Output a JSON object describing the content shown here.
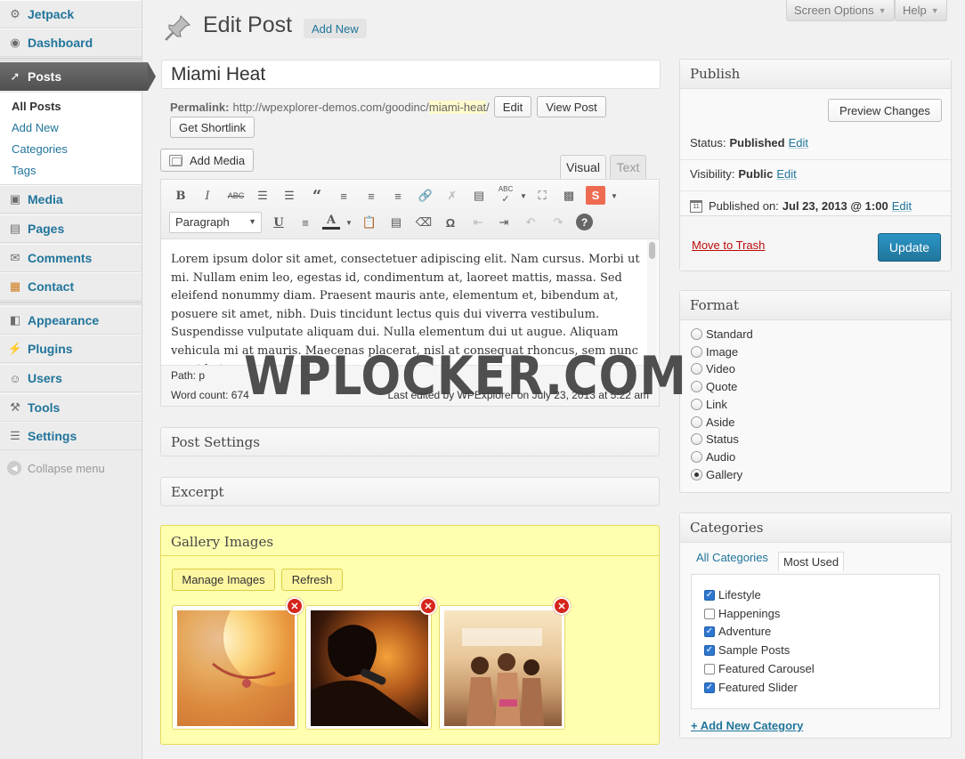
{
  "sidebar": {
    "menu": {
      "jetpack": {
        "label": "Jetpack",
        "icon": "jetpack-icon"
      },
      "dashboard": {
        "label": "Dashboard",
        "icon": "dashboard-icon"
      },
      "posts": {
        "label": "Posts",
        "icon": "pushpin-icon"
      },
      "media": {
        "label": "Media",
        "icon": "media-icon"
      },
      "pages": {
        "label": "Pages",
        "icon": "pages-icon"
      },
      "comments": {
        "label": "Comments",
        "icon": "comments-icon"
      },
      "contact": {
        "label": "Contact",
        "icon": "contact-icon"
      },
      "appearance": {
        "label": "Appearance",
        "icon": "appearance-icon"
      },
      "plugins": {
        "label": "Plugins",
        "icon": "plugins-icon"
      },
      "users": {
        "label": "Users",
        "icon": "users-icon"
      },
      "tools": {
        "label": "Tools",
        "icon": "tools-icon"
      },
      "settings": {
        "label": "Settings",
        "icon": "settings-icon"
      }
    },
    "submenu": [
      "All Posts",
      "Add New",
      "Categories",
      "Tags"
    ],
    "collapse_label": "Collapse menu"
  },
  "header": {
    "title": "Edit Post",
    "add_new": "Add New",
    "screen_options": "Screen Options",
    "help": "Help"
  },
  "post": {
    "title": "Miami Heat",
    "permalink_label": "Permalink:",
    "permalink_base": "http://wpexplorer-demos.com/goodinc/",
    "permalink_slug": "miami-heat",
    "permalink_end": "/",
    "edit_label": "Edit",
    "view_post_label": "View Post",
    "shortlink_label": "Get Shortlink"
  },
  "editor": {
    "add_media": "Add Media",
    "tab_visual": "Visual",
    "tab_text": "Text",
    "format_value": "Paragraph",
    "content": "Lorem ipsum dolor sit amet, consectetuer adipiscing elit. Nam cursus. Morbi ut mi. Nullam enim leo, egestas id, condimentum at, laoreet mattis, massa. Sed eleifend nonummy diam. Praesent mauris ante, elementum et, bibendum at, posuere sit amet, nibh. Duis tincidunt lectus quis dui viverra vestibulum. Suspendisse vulputate aliquam dui. Nulla elementum dui ut augue. Aliquam vehicula mi at mauris. Maecenas placerat, nisl at consequat rhoncus, sem nunc gravida justo, quis",
    "path": "Path: p",
    "word_count": "Word count: 674",
    "last_edited": "Last edited by WPExplorer on July 23, 2013 at 5:22 am"
  },
  "boxes": {
    "post_settings": "Post Settings",
    "excerpt": "Excerpt",
    "gallery": {
      "title": "Gallery Images",
      "manage": "Manage Images",
      "refresh": "Refresh",
      "images": [
        "gallery-image-warm-portrait",
        "gallery-image-singer-microphone",
        "gallery-image-festival-crowd"
      ]
    }
  },
  "publish": {
    "title": "Publish",
    "preview": "Preview Changes",
    "status_label": "Status:",
    "status_value": "Published",
    "visibility_label": "Visibility:",
    "visibility_value": "Public",
    "published_label": "Published on:",
    "published_value": "Jul 23, 2013 @ 1:00",
    "edit": "Edit",
    "trash": "Move to Trash",
    "update": "Update"
  },
  "format": {
    "title": "Format",
    "options": [
      "Standard",
      "Image",
      "Video",
      "Quote",
      "Link",
      "Aside",
      "Status",
      "Audio",
      "Gallery"
    ],
    "selected": "Gallery"
  },
  "categories": {
    "title": "Categories",
    "tab_all": "All Categories",
    "tab_most": "Most Used",
    "items": [
      {
        "label": "Lifestyle",
        "checked": true
      },
      {
        "label": "Happenings",
        "checked": false
      },
      {
        "label": "Adventure",
        "checked": true
      },
      {
        "label": "Sample Posts",
        "checked": true
      },
      {
        "label": "Featured Carousel",
        "checked": false
      },
      {
        "label": "Featured Slider",
        "checked": true
      }
    ],
    "add_new": "+ Add New Category"
  },
  "watermark": "WPLOCKER.COM",
  "colors": {
    "link": "#21759b",
    "sidebar_active": "#5a5a5a",
    "update_button": "#21759b",
    "gallery_bg": "#ffffb0",
    "trash": "#bc0b0b"
  }
}
